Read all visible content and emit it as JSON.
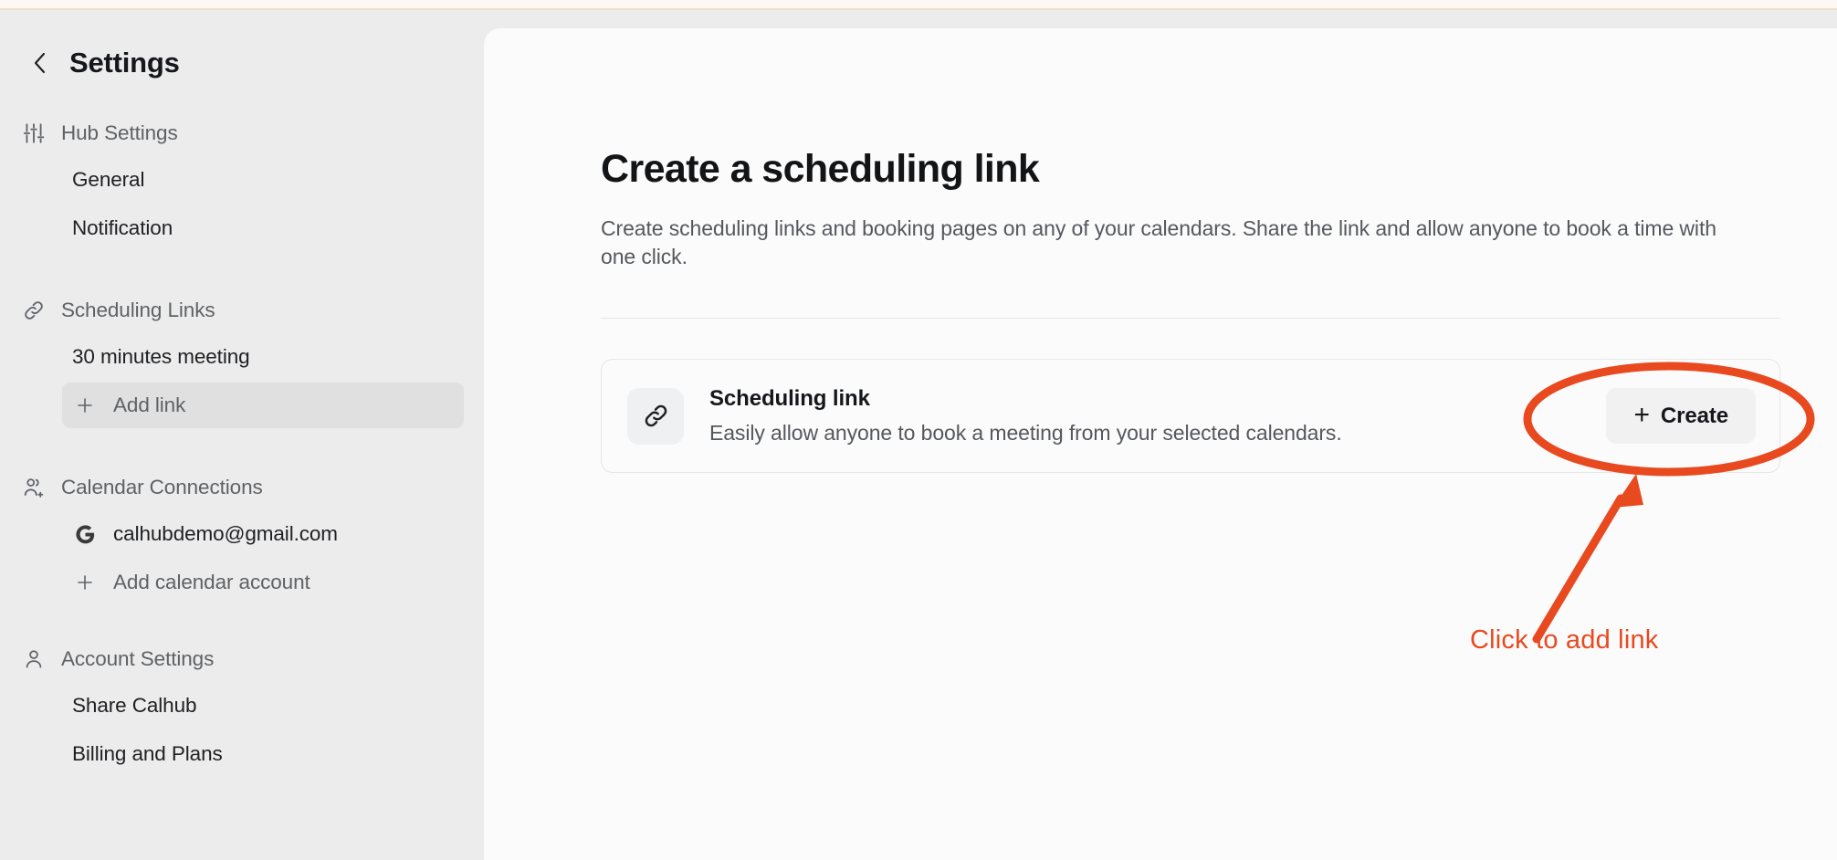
{
  "theme": {
    "accent_annotation": "#e8491f",
    "sidebar_bg": "#ececec",
    "panel_bg": "#fbfbfb",
    "top_strip": "#fdf8f3",
    "active_item_bg": "#e0e0e0"
  },
  "sidebar": {
    "back_icon": "chevron-left-icon",
    "title": "Settings",
    "groups": [
      {
        "icon": "sliders-icon",
        "label": "Hub Settings",
        "items": [
          {
            "label": "General",
            "icon": null,
            "active": false
          },
          {
            "label": "Notification",
            "icon": null,
            "active": false
          }
        ]
      },
      {
        "icon": "link-icon",
        "label": "Scheduling Links",
        "items": [
          {
            "label": "30 minutes meeting",
            "icon": null,
            "active": false
          },
          {
            "label": "Add link",
            "icon": "plus-icon",
            "active": true
          }
        ]
      },
      {
        "icon": "users-add-icon",
        "label": "Calendar Connections",
        "items": [
          {
            "label": "calhubdemo@gmail.com",
            "icon": "google-g-icon",
            "active": false
          },
          {
            "label": "Add calendar account",
            "icon": "plus-icon",
            "active": false
          }
        ]
      },
      {
        "icon": "user-icon",
        "label": "Account Settings",
        "items": [
          {
            "label": "Share Calhub",
            "icon": null,
            "active": false
          },
          {
            "label": "Billing and Plans",
            "icon": null,
            "active": false
          }
        ]
      }
    ]
  },
  "main": {
    "title": "Create a scheduling link",
    "subtitle": "Create scheduling links and booking pages on any of your calendars. Share the link and allow anyone to book a time with one click.",
    "card": {
      "icon": "link-icon",
      "title": "Scheduling link",
      "description": "Easily allow anyone to book a meeting from your selected calendars.",
      "button_label": "Create",
      "button_plus": "+"
    }
  },
  "annotation": {
    "label": "Click to add link",
    "shape": "ellipse-highlight",
    "arrow": "arrow-pointing-up",
    "color": "#e8491f"
  }
}
